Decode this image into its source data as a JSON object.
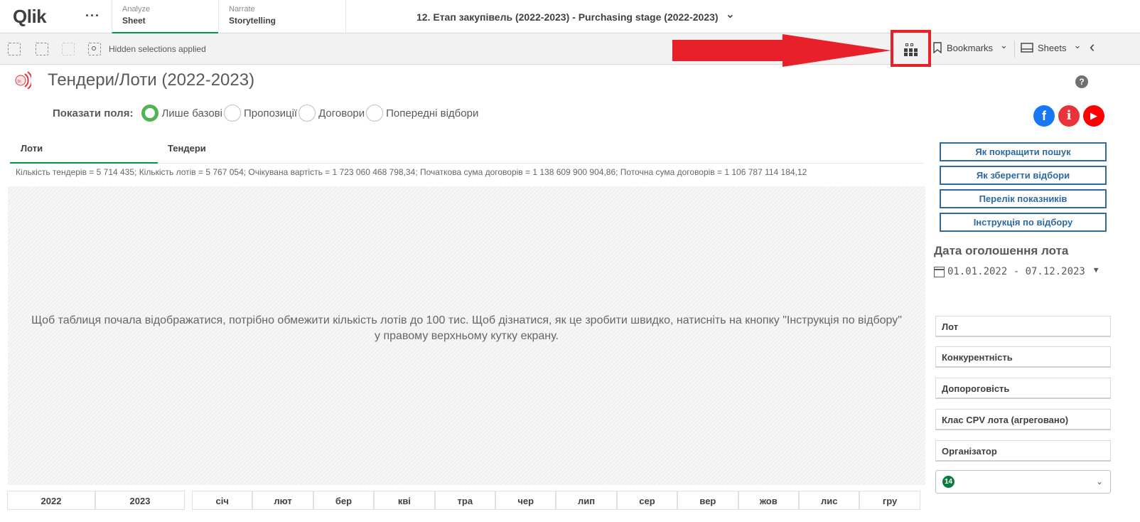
{
  "header": {
    "logo": "Qlik",
    "more": "···",
    "tabs": [
      {
        "small": "Analyze",
        "big": "Sheet"
      },
      {
        "small": "Narrate",
        "big": "Storytelling"
      }
    ],
    "app_title": "12. Етап закупівель (2022-2023) - Purchasing stage (2022-2023)",
    "app_title_chevron": "⌄"
  },
  "toolbar": {
    "hidden_selections": "Hidden selections applied",
    "bookmarks": "Bookmarks",
    "sheets": "Sheets",
    "chevron": "⌄",
    "collapse": "‹"
  },
  "sheet": {
    "title": "Тендери/Лоти (2022-2023)",
    "help": "?",
    "fields_label": "Показати поля:",
    "field_options": [
      "Лише базові",
      "Пропозиції",
      "Договори",
      "Попередні відбори"
    ],
    "selected_option": "Лише базові",
    "social": {
      "facebook": "f",
      "info": "i",
      "youtube": "▶"
    },
    "social_colors": {
      "facebook": "#1877f2",
      "info": "#e8323c",
      "youtube": "#ff0000"
    }
  },
  "tabs": [
    "Лоти",
    "Тендери"
  ],
  "kpi_line": "Кількість тендерів = 5 714 435; Кількість лотів = 5 767 054; Очікувана вартість = 1 723 060 468 798,34; Початкова сума договорів = 1 138 609 900 904,86; Поточна сума договорів = 1 106 787 114 184,12",
  "table_message": {
    "line1": "Щоб таблиця почала відображатися, потрібно обмежити кількість лотів до 100 тис. Щоб дізнатися, як це зробити швидко, натисніть на кнопку \"Інструкція по відбору\"",
    "line2": "у правому верхньому кутку екрану."
  },
  "right_panel": {
    "buttons": [
      "Як покращити пошук",
      "Як зберегти відбори",
      "Перелік показників",
      "Інструкція по відбору"
    ],
    "date_title": "Дата оголошення лота",
    "date_value": "01.01.2022 - 07.12.2023",
    "date_arrow": "▼",
    "filters": [
      "Лот",
      "Конкурентність",
      "Допороговість",
      "Клас CPV лота (агреговано)",
      "Організатор"
    ],
    "counter": "14",
    "counter_chevron": "⌄"
  },
  "bottom": {
    "years": [
      "2022",
      "2023"
    ],
    "months": [
      "січ",
      "лют",
      "бер",
      "кві",
      "тра",
      "чер",
      "лип",
      "сер",
      "вер",
      "жов",
      "лис",
      "гру"
    ]
  },
  "colors": {
    "accent_green": "#009845",
    "link_blue": "#2d6a9f",
    "annotation_red": "#e8202a"
  }
}
